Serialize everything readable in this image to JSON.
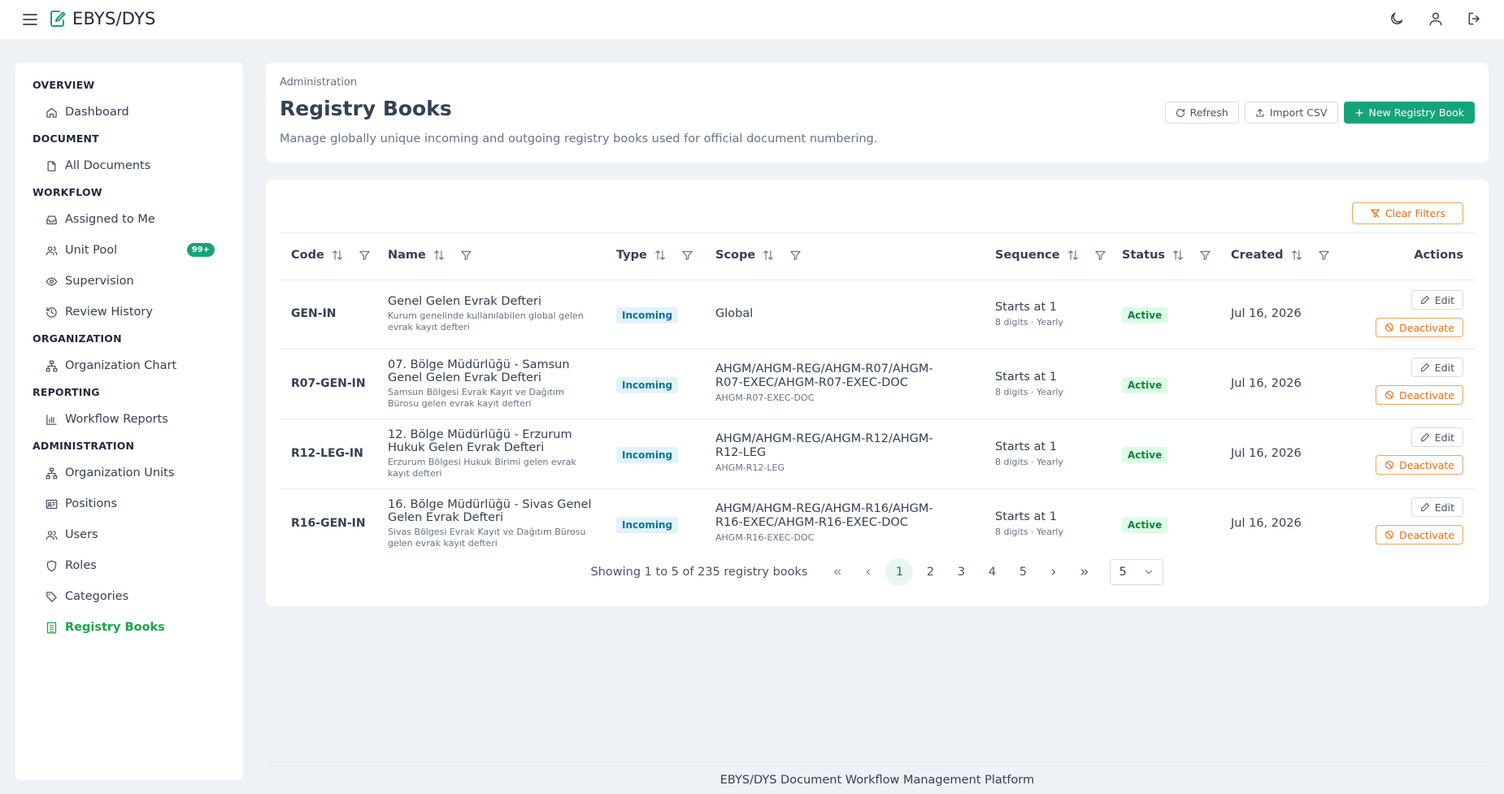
{
  "app": {
    "title": "EBYS/DYS"
  },
  "sidebar": {
    "sections": [
      {
        "title": "OVERVIEW",
        "items": [
          {
            "label": "Dashboard",
            "icon": "home-icon"
          }
        ]
      },
      {
        "title": "DOCUMENT",
        "items": [
          {
            "label": "All Documents",
            "icon": "file-icon"
          }
        ]
      },
      {
        "title": "WORKFLOW",
        "items": [
          {
            "label": "Assigned to Me",
            "icon": "inbox-icon"
          },
          {
            "label": "Unit Pool",
            "icon": "users-icon",
            "badge": "99+"
          },
          {
            "label": "Supervision",
            "icon": "eye-icon"
          },
          {
            "label": "Review History",
            "icon": "history-icon"
          }
        ]
      },
      {
        "title": "ORGANIZATION",
        "items": [
          {
            "label": "Organization Chart",
            "icon": "org-chart-icon"
          }
        ]
      },
      {
        "title": "REPORTING",
        "items": [
          {
            "label": "Workflow Reports",
            "icon": "bar-chart-icon"
          }
        ]
      },
      {
        "title": "ADMINISTRATION",
        "items": [
          {
            "label": "Organization Units",
            "icon": "org-units-icon"
          },
          {
            "label": "Positions",
            "icon": "id-card-icon"
          },
          {
            "label": "Users",
            "icon": "users-icon"
          },
          {
            "label": "Roles",
            "icon": "shield-icon"
          },
          {
            "label": "Categories",
            "icon": "tag-icon"
          },
          {
            "label": "Registry Books",
            "icon": "book-icon",
            "active": true
          }
        ]
      }
    ]
  },
  "header": {
    "breadcrumb": "Administration",
    "title": "Registry Books",
    "description": "Manage globally unique incoming and outgoing registry books used for official document numbering.",
    "refresh_label": "Refresh",
    "import_label": "Import CSV",
    "new_label": "New Registry Book"
  },
  "table": {
    "clear_filters_label": "Clear Filters",
    "columns": {
      "code": "Code",
      "name": "Name",
      "type": "Type",
      "scope": "Scope",
      "sequence": "Sequence",
      "status": "Status",
      "created": "Created",
      "actions": "Actions"
    },
    "edit_label": "Edit",
    "deactivate_label": "Deactivate",
    "rows": [
      {
        "code": "GEN-IN",
        "name": "Genel Gelen Evrak Defteri",
        "name_sub": "Kurum genelinde kullanılabilen global gelen evrak kayıt defteri",
        "type": "Incoming",
        "scope": "Global",
        "scope_sub": "",
        "sequence": "Starts at 1",
        "sequence_sub": "8 digits · Yearly",
        "status": "Active",
        "created": "Jul 16, 2026"
      },
      {
        "code": "R07-GEN-IN",
        "name": "07. Bölge Müdürlüğü - Samsun Genel Gelen Evrak Defteri",
        "name_sub": "Samsun Bölgesi Evrak Kayıt ve Dağıtım Bürosu gelen evrak kayıt defteri",
        "type": "Incoming",
        "scope": "AHGM/AHGM-REG/AHGM-R07/AHGM-R07-EXEC/AHGM-R07-EXEC-DOC",
        "scope_sub": "AHGM-R07-EXEC-DOC",
        "sequence": "Starts at 1",
        "sequence_sub": "8 digits · Yearly",
        "status": "Active",
        "created": "Jul 16, 2026"
      },
      {
        "code": "R12-LEG-IN",
        "name": "12. Bölge Müdürlüğü - Erzurum Hukuk Gelen Evrak Defteri",
        "name_sub": "Erzurum Bölgesi Hukuk Birimi gelen evrak kayıt defteri",
        "type": "Incoming",
        "scope": "AHGM/AHGM-REG/AHGM-R12/AHGM-R12-LEG",
        "scope_sub": "AHGM-R12-LEG",
        "sequence": "Starts at 1",
        "sequence_sub": "8 digits · Yearly",
        "status": "Active",
        "created": "Jul 16, 2026"
      },
      {
        "code": "R16-GEN-IN",
        "name": "16. Bölge Müdürlüğü - Sivas Genel Gelen Evrak Defteri",
        "name_sub": "Sivas Bölgesi Evrak Kayıt ve Dağıtım Bürosu gelen evrak kayıt defteri",
        "type": "Incoming",
        "scope": "AHGM/AHGM-REG/AHGM-R16/AHGM-R16-EXEC/AHGM-R16-EXEC-DOC",
        "scope_sub": "AHGM-R16-EXEC-DOC",
        "sequence": "Starts at 1",
        "sequence_sub": "8 digits · Yearly",
        "status": "Active",
        "created": "Jul 16, 2026"
      }
    ]
  },
  "pagination": {
    "info": "Showing 1 to 5 of 235 registry books",
    "pages": [
      "1",
      "2",
      "3",
      "4",
      "5"
    ],
    "current": "1",
    "per_page": "5"
  },
  "footer": {
    "text": "EBYS/DYS Document Workflow Management Platform"
  },
  "colors": {
    "accent": "#16a37a",
    "warning": "#ea6c10",
    "incoming_badge_bg": "#e0f2fe",
    "active_badge_bg": "#dcfce7"
  }
}
